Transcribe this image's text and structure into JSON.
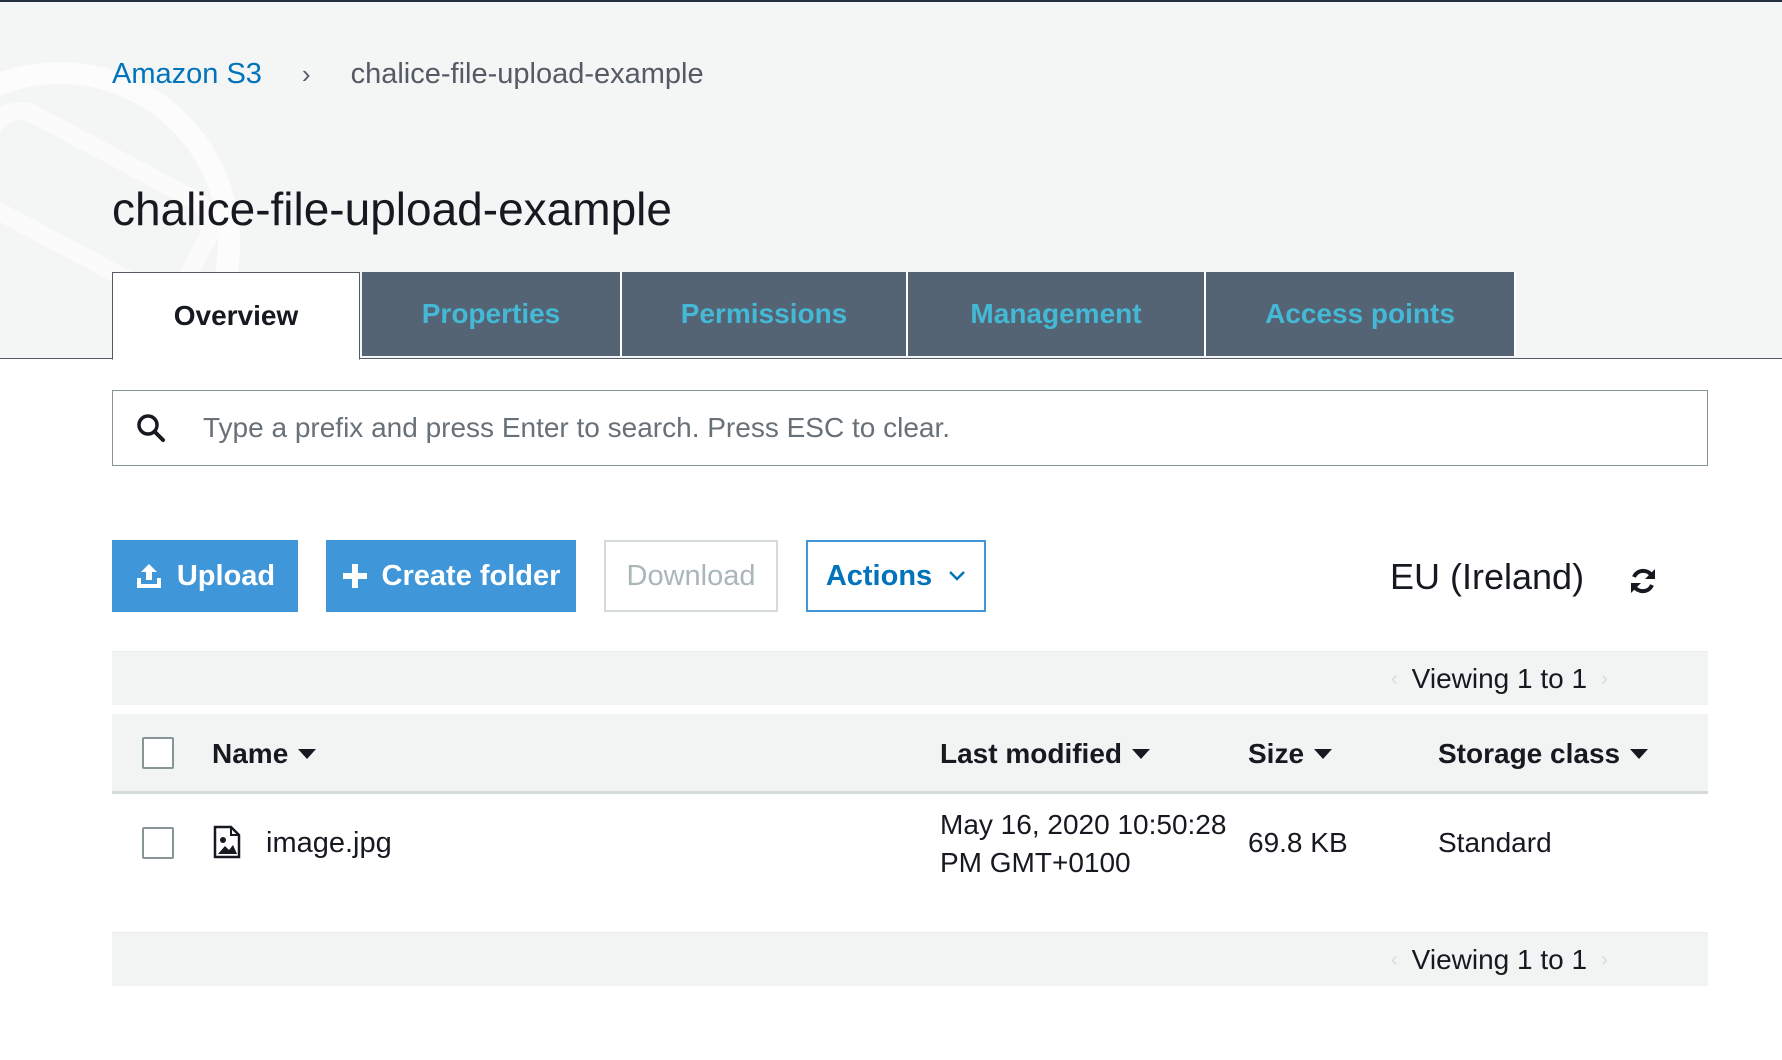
{
  "breadcrumb": {
    "root": "Amazon S3",
    "separator": "›",
    "current": "chalice-file-upload-example"
  },
  "page_title": "chalice-file-upload-example",
  "tabs": [
    {
      "label": "Overview",
      "active": true
    },
    {
      "label": "Properties",
      "active": false
    },
    {
      "label": "Permissions",
      "active": false
    },
    {
      "label": "Management",
      "active": false
    },
    {
      "label": "Access points",
      "active": false
    }
  ],
  "search": {
    "placeholder": "Type a prefix and press Enter to search. Press ESC to clear.",
    "value": "",
    "icon": "search-icon"
  },
  "toolbar": {
    "upload_label": "Upload",
    "create_folder_label": "Create folder",
    "download_label": "Download",
    "actions_label": "Actions",
    "region": "EU (Ireland)"
  },
  "pager": {
    "text": "Viewing 1 to 1",
    "prev": "‹",
    "next": "›"
  },
  "table": {
    "columns": [
      "Name",
      "Last modified",
      "Size",
      "Storage class"
    ],
    "rows": [
      {
        "name": "image.jpg",
        "last_modified_line1": "May 16, 2020 10:50:28",
        "last_modified_line2": "PM GMT+0100",
        "size": "69.8 KB",
        "storage_class": "Standard"
      }
    ]
  },
  "colors": {
    "primary_button": "#3f96d8",
    "tab_background": "#546474",
    "tab_text": "#44b9d6",
    "link": "#0073bb"
  }
}
